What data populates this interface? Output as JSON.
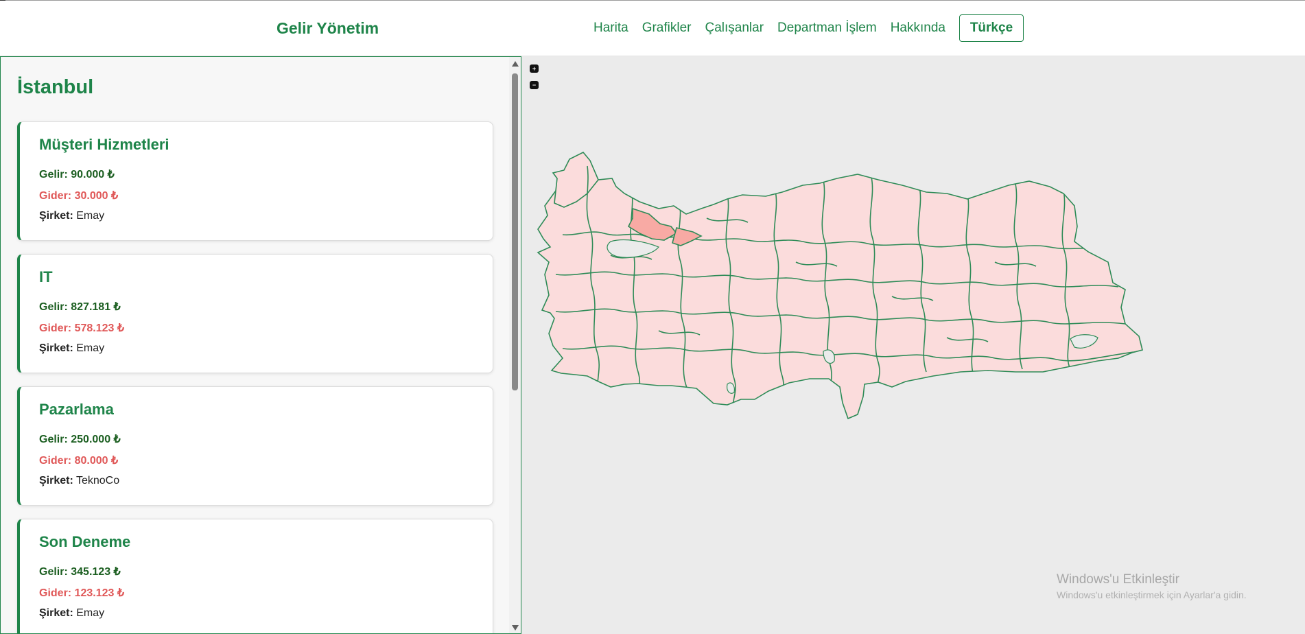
{
  "header": {
    "brand": "Gelir Yönetim",
    "nav": [
      "Harita",
      "Grafikler",
      "Çalışanlar",
      "Departman İşlem",
      "Hakkında"
    ],
    "language_button": "Türkçe"
  },
  "sidebar": {
    "city": "İstanbul",
    "departments": [
      {
        "name": "Müşteri Hizmetleri",
        "income_label": "Gelir:",
        "income": "90.000 ₺",
        "expense_label": "Gider:",
        "expense": "30.000 ₺",
        "company_label": "Şirket:",
        "company": "Emay"
      },
      {
        "name": "IT",
        "income_label": "Gelir:",
        "income": "827.181 ₺",
        "expense_label": "Gider:",
        "expense": "578.123 ₺",
        "company_label": "Şirket:",
        "company": "Emay"
      },
      {
        "name": "Pazarlama",
        "income_label": "Gelir:",
        "income": "250.000 ₺",
        "expense_label": "Gider:",
        "expense": "80.000 ₺",
        "company_label": "Şirket:",
        "company": "TeknoCo"
      },
      {
        "name": "Son Deneme",
        "income_label": "Gelir:",
        "income": "345.123 ₺",
        "expense_label": "Gider:",
        "expense": "123.123 ₺",
        "company_label": "Şirket:",
        "company": "Emay"
      }
    ]
  },
  "map": {
    "zoom_in": "+",
    "zoom_out": "−",
    "province_fill": "#fbdcdc",
    "selected_fill": "#f8aaa4",
    "border_color": "#2e8b57"
  },
  "watermark": {
    "title": "Windows'u Etkinleştir",
    "subtitle": "Windows'u etkinleştirmek için Ayarlar'a gidin."
  },
  "colors": {
    "accent": "#1e8449",
    "income": "#1b5e20",
    "expense": "#e05858"
  }
}
